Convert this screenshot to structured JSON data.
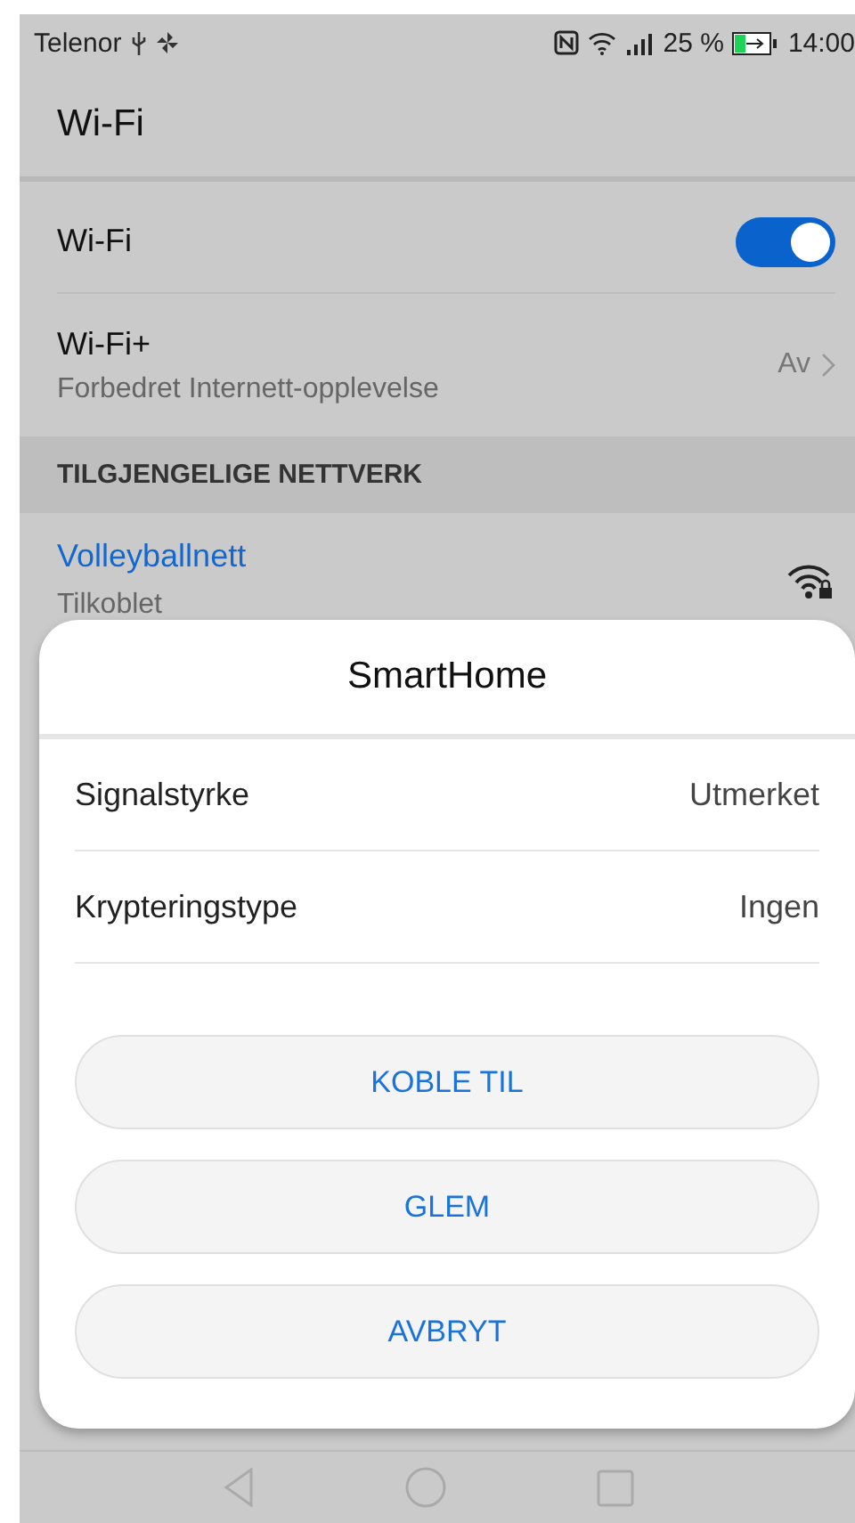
{
  "status_bar": {
    "carrier": "Telenor",
    "battery_percent": "25 %",
    "time": "14:00"
  },
  "app_bar": {
    "title": "Wi-Fi"
  },
  "wifi_toggle": {
    "label": "Wi-Fi",
    "on": true
  },
  "wifi_plus": {
    "label": "Wi-Fi+",
    "subtitle": "Forbedret Internett-opplevelse",
    "value": "Av"
  },
  "section_header": "TILGJENGELIGE NETTVERK",
  "networks": [
    {
      "name": "Volleyballnett",
      "status": "Tilkoblet",
      "selected": true,
      "locked": true
    }
  ],
  "dialog": {
    "title": "SmartHome",
    "details": [
      {
        "label": "Signalstyrke",
        "value": "Utmerket"
      },
      {
        "label": "Krypteringstype",
        "value": "Ingen"
      }
    ],
    "buttons": [
      "KOBLE TIL",
      "GLEM",
      "AVBRYT"
    ]
  }
}
